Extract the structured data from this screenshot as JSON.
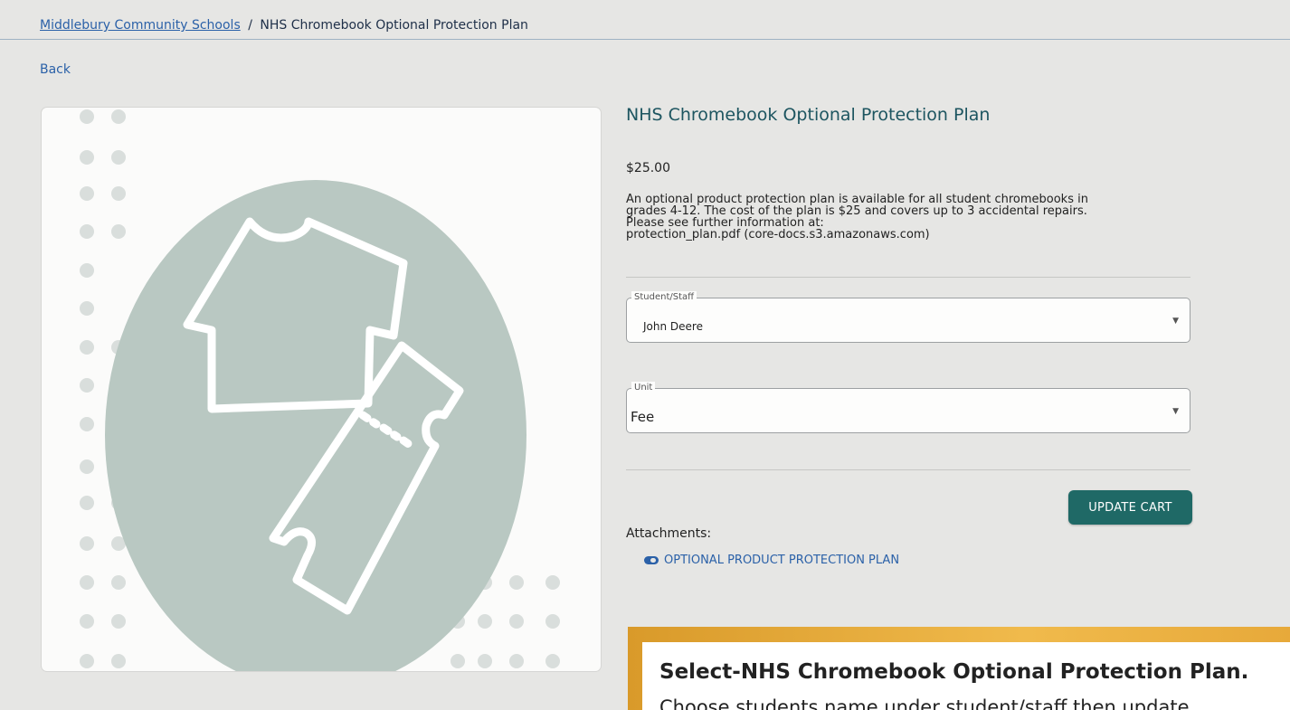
{
  "breadcrumb": {
    "home": "Middlebury Community Schools",
    "separator": "/",
    "current": "NHS Chromebook Optional Protection Plan"
  },
  "nav": {
    "back": "Back"
  },
  "product": {
    "image_icon": "tshirt-ticket-icon",
    "title": "NHS Chromebook Optional Protection Plan",
    "price": "$25.00",
    "description_line1": "An optional product protection plan is available for all student chromebooks in",
    "description_line2": "grades 4-12. The cost of the plan is $25 and covers up to 3 accidental repairs.",
    "description_line3": "Please see further information at:",
    "description_link": "protection_plan.pdf (core-docs.s3.amazonaws.com)"
  },
  "form": {
    "student_label": "Student/Staff",
    "student_value": "John Deere",
    "unit_label": "Unit",
    "unit_value": "Fee",
    "dropdown_icon": "chevron-down-icon",
    "update_cart": "UPDATE CART"
  },
  "attachments": {
    "label": "Attachments:",
    "items": [
      {
        "icon": "pill-icon",
        "label": "OPTIONAL PRODUCT PROTECTION PLAN"
      }
    ]
  },
  "callout": {
    "title": "Select-NHS Chromebook Optional Protection Plan.",
    "body": "Choose students name under student/staff then update"
  },
  "colors": {
    "background": "#e6e6e4",
    "accent": "#1f6966",
    "link": "#2b61a8",
    "title": "#1d5560",
    "image_circle": "#b9c8c2",
    "callout_border": "#eab04a"
  }
}
